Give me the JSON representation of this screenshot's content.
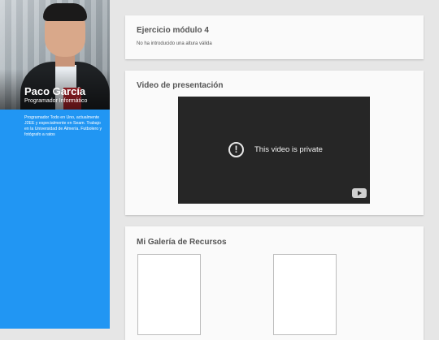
{
  "profile": {
    "name": "Paco García",
    "role": "Programador Informático",
    "bio": "Programador Todo en Uno, actualmente J2EE y especialmente en Seam. Trabajo en la Universidad de Almería. Futbolero y fotógrafo a ratos"
  },
  "cards": {
    "exercise": {
      "title": "Ejercicio módulo 4",
      "message": "No ha introducido una altura válida"
    },
    "video": {
      "title": "Video de presentación",
      "status_text": "This video is private",
      "alert_symbol": "!"
    },
    "gallery": {
      "title": "Mi Galería de Recursos"
    }
  },
  "colors": {
    "sidebar": "#2196f3",
    "background": "#e6e6e6",
    "video_bg": "#262626"
  }
}
